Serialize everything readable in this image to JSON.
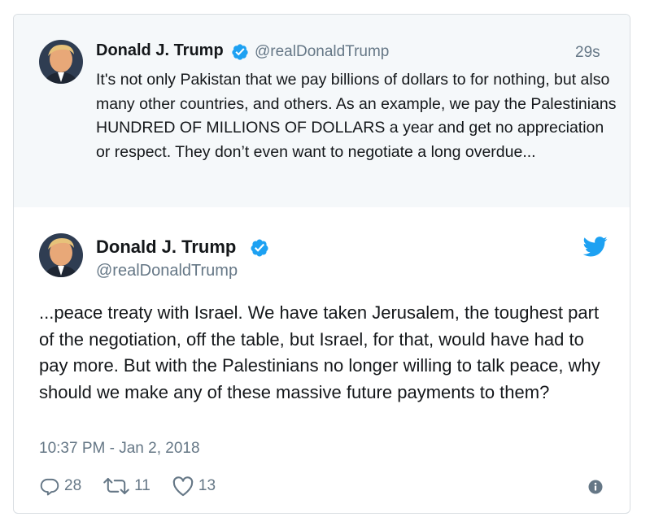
{
  "parent_tweet": {
    "author_name": "Donald J. Trump",
    "handle": "@realDonaldTrump",
    "time": "29s",
    "text": "It's not only Pakistan that we pay billions of dollars to for nothing, but also many other countries, and others. As an example, we pay the Palestinians HUNDRED OF MILLIONS OF DOLLARS a year and get no appreciation or respect. They don’t even want to negotiate a long overdue...",
    "verified_icon": "verified-badge-icon",
    "avatar": "profile-photo"
  },
  "main_tweet": {
    "author_name": "Donald J. Trump",
    "handle": "@realDonaldTrump",
    "text": "...peace treaty with Israel. We have taken Jerusalem, the toughest part of the negotiation, off the table, but Israel, for that, would have had to pay more. But with the Palestinians no longer willing to talk peace, why should we make any of these massive future payments to them?",
    "timestamp": "10:37 PM - Jan 2, 2018",
    "logo_icon": "twitter-bird-icon",
    "actions": {
      "replies": "28",
      "retweets": "11",
      "likes": "13"
    }
  },
  "colors": {
    "text": "#14171a",
    "secondary": "#657786",
    "accent": "#1da1f2",
    "parent_bg": "#f5f8fa",
    "border": "#d9dee2"
  }
}
